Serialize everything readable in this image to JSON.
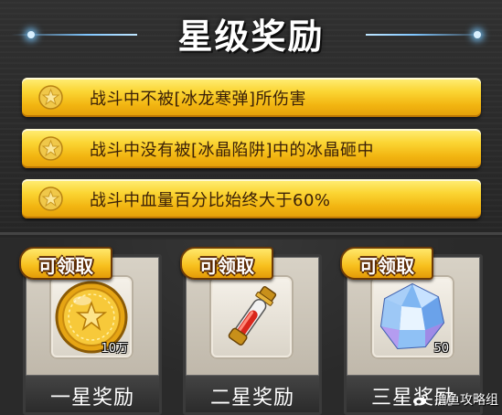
{
  "header": {
    "title": "星级奖励"
  },
  "conditions": [
    {
      "text": "战斗中不被[冰龙寒弹]所伤害",
      "icon": "star-icon"
    },
    {
      "text": "战斗中没有被[冰晶陷阱]中的冰晶砸中",
      "icon": "star-icon"
    },
    {
      "text": "战斗中血量百分比始终大于60%",
      "icon": "star-icon"
    }
  ],
  "rewards": [
    {
      "tag": "可领取",
      "label": "一星奖励",
      "icon": "gold-coin-icon",
      "quantity": "10万"
    },
    {
      "tag": "可领取",
      "label": "二星奖励",
      "icon": "red-potion-icon",
      "quantity": ""
    },
    {
      "tag": "可领取",
      "label": "三星奖励",
      "icon": "blue-crystal-icon",
      "quantity": "50"
    }
  ],
  "watermark": {
    "text": "撸鱼攻略组"
  },
  "colors": {
    "accent_gold": "#f7bf1c",
    "bar_text": "#3a2008",
    "deco_blue": "#7fc6ff"
  }
}
